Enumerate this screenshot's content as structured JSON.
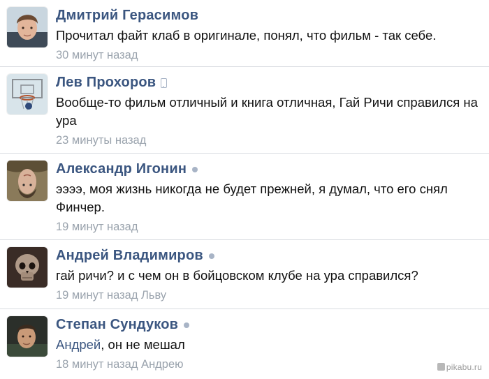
{
  "comments": [
    {
      "author": "Дмитрий Герасимов",
      "status_icon": "",
      "text": "Прочитал файт клаб в оригинале, понял, что фильм - так себе.",
      "reply_to": "",
      "time": "30 минут назад",
      "avatar_icon": "young-man-photo"
    },
    {
      "author": "Лев Прохоров",
      "status_icon": "mobile-phone-icon",
      "text": "Вообще-то фильм отличный и книга отличная, Гай Ричи справился на ура",
      "reply_to": "",
      "time": "23 минуты назад",
      "avatar_icon": "basketball-hoop-photo"
    },
    {
      "author": "Александр Игонин",
      "status_icon": "online-dot",
      "text": "ээээ, моя жизнь никогда не будет прежней, я думал, что его снял Финчер.",
      "reply_to": "",
      "time": "19 минут назад",
      "avatar_icon": "upside-down-face-photo"
    },
    {
      "author": "Андрей Владимиров",
      "status_icon": "online-dot",
      "text": "гай ричи? и с чем он в бойцовском клубе на ура справился?",
      "reply_to": "",
      "time": "19 минут назад Льву",
      "avatar_icon": "skull-photo"
    },
    {
      "author": "Степан Сундуков",
      "status_icon": "online-dot",
      "text": ", он не мешал",
      "reply_to": "Андрей",
      "time": "18 минут назад Андрею",
      "avatar_icon": "man-portrait-photo"
    }
  ],
  "watermark": "pikabu.ru",
  "colors": {
    "author": "#3b5680",
    "text": "#111111",
    "meta": "#9aa3ad",
    "divider": "#d9dce1",
    "status": "#a8b4c6"
  }
}
